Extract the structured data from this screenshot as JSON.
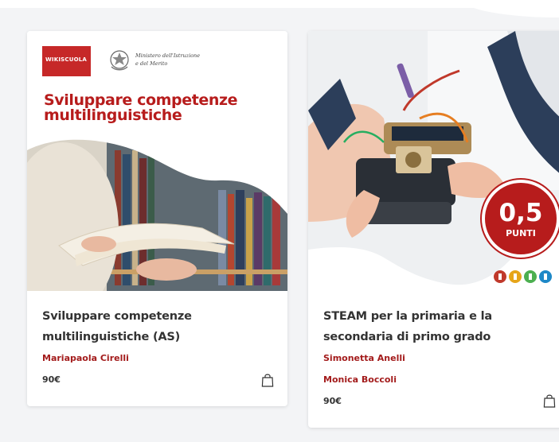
{
  "courses": [
    {
      "cover": {
        "brand": "WIKISCUOLA",
        "ministry": "Ministero dell'Istruzione\ne del Merito",
        "title": "Sviluppare competenze\nmultilinguistiche",
        "image": "person-reading-book-in-library"
      },
      "title": "Sviluppare competenze\nmultilinguistiche (AS)",
      "authors": [
        "Mariapaola Cirelli"
      ],
      "price": "90€",
      "cart_icon": "shopping-bag-icon"
    },
    {
      "cover": {
        "image": "child-building-robot",
        "badge_value": "0,5",
        "badge_unit": "PUNTI",
        "badge_logo": "miur-logo"
      },
      "title": "STEAM per la primaria e la\nsecondaria di primo grado",
      "authors": [
        "Simonetta Anelli",
        "Monica Boccoli"
      ],
      "price": "90€",
      "cart_icon": "shopping-bag-icon"
    }
  ],
  "colors": {
    "accent": "#a31b1b",
    "brand_red": "#c62828",
    "text": "#333333",
    "background": "#f3f4f6"
  }
}
